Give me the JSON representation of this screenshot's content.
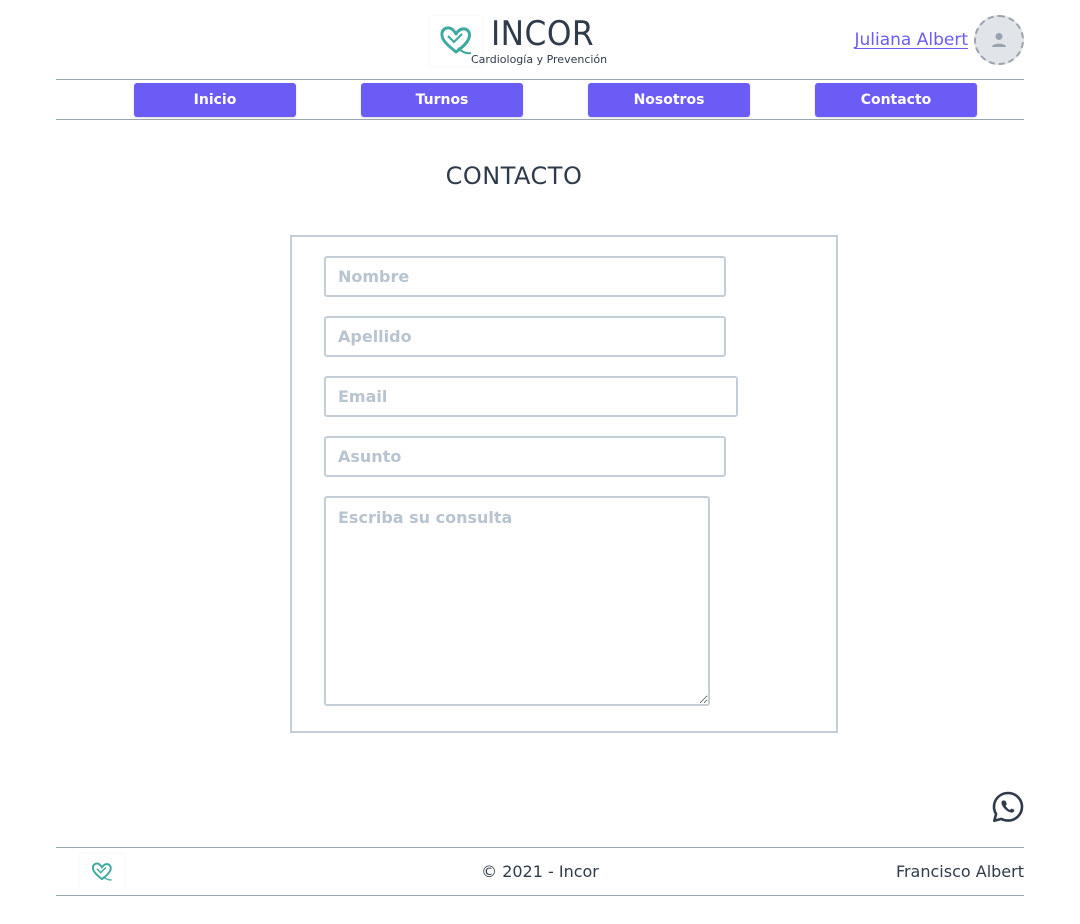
{
  "header": {
    "brand_title": "INCOR",
    "brand_subtitle": "Cardiología y Prevención",
    "user_name": "Juliana Albert"
  },
  "nav": {
    "items": [
      {
        "label": "Inicio"
      },
      {
        "label": "Turnos"
      },
      {
        "label": "Nosotros"
      },
      {
        "label": "Contacto"
      }
    ]
  },
  "main": {
    "title": "CONTACTO",
    "form": {
      "nombre_placeholder": "Nombre",
      "apellido_placeholder": "Apellido",
      "email_placeholder": "Email",
      "asunto_placeholder": "Asunto",
      "consulta_placeholder": "Escriba su consulta"
    }
  },
  "footer": {
    "copyright": "© 2021 - Incor",
    "author": "Francisco Albert"
  },
  "colors": {
    "accent": "#6c5cf6",
    "logo_teal": "#3fa9a0",
    "border": "#c5ced6",
    "text": "#2f3b4a"
  },
  "icons": {
    "logo": "heart-stethoscope-icon",
    "avatar": "user-icon",
    "whatsapp": "whatsapp-icon"
  }
}
